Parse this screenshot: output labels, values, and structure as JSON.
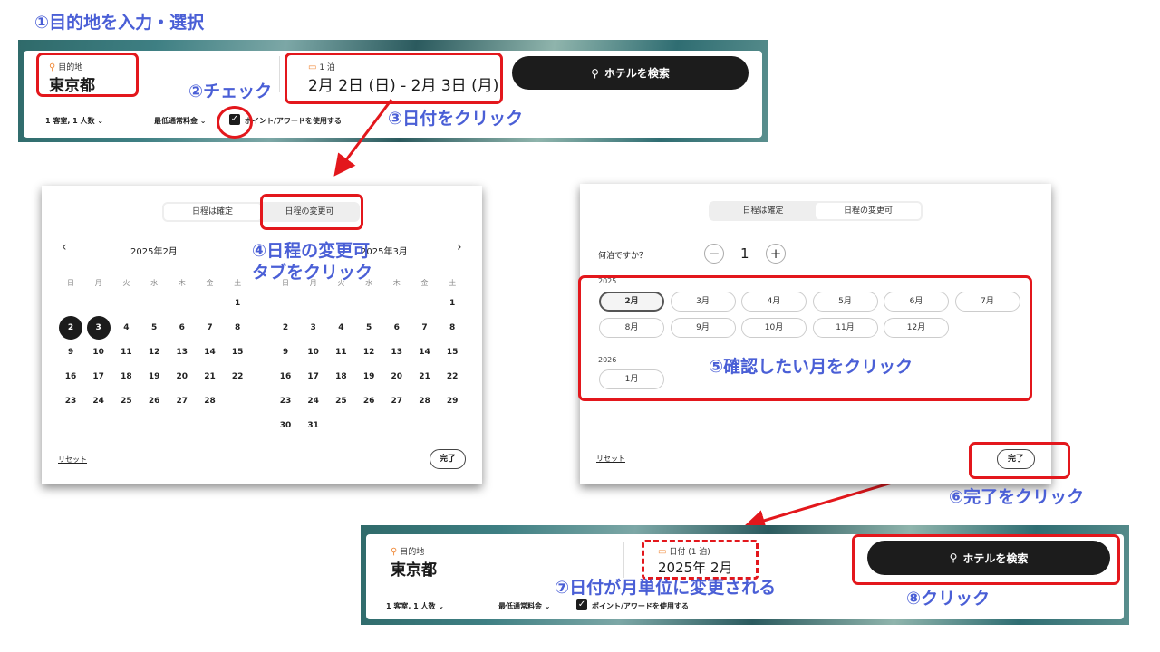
{
  "annotations": {
    "step1": "①目的地を入力・選択",
    "step2": "②チェック",
    "step3": "③日付をクリック",
    "step4_line1": "④日程の変更可",
    "step4_line2": "タブをクリック",
    "step5": "⑤確認したい月をクリック",
    "step6": "⑥完了をクリック",
    "step7": "⑦日付が月単位に変更される",
    "step8": "⑧クリック"
  },
  "top_bar": {
    "destination_label": "目的地",
    "destination_value": "東京都",
    "nights_label": "1 泊",
    "date_value": "2月 2日 (日) - 2月 3日 (月)",
    "search_label": "ホテルを検索",
    "guests": "1 客室, 1 人数",
    "rate": "最低通常料金",
    "points_label": "ポイント/アワードを使用する"
  },
  "calendar_panel": {
    "tab_fixed": "日程は確定",
    "tab_flexible": "日程の変更可",
    "month_left": "2025年2月",
    "month_right": "2025年3月",
    "weekdays": [
      "日",
      "月",
      "火",
      "水",
      "木",
      "金",
      "土"
    ],
    "feb_days": [
      "1",
      "2",
      "3",
      "4",
      "5",
      "6",
      "7",
      "8",
      "9",
      "10",
      "11",
      "12",
      "13",
      "14",
      "15",
      "16",
      "17",
      "18",
      "19",
      "20",
      "21",
      "22",
      "23",
      "24",
      "25",
      "26",
      "27",
      "28"
    ],
    "mar_days": [
      "1",
      "2",
      "3",
      "4",
      "5",
      "6",
      "7",
      "8",
      "9",
      "10",
      "11",
      "12",
      "13",
      "14",
      "15",
      "16",
      "17",
      "18",
      "19",
      "20",
      "21",
      "22",
      "23",
      "24",
      "25",
      "26",
      "27",
      "28",
      "29",
      "30",
      "31"
    ],
    "selected_days": [
      "2",
      "3"
    ],
    "reset": "リセット",
    "done": "完了"
  },
  "flex_panel": {
    "tab_fixed": "日程は確定",
    "tab_flexible": "日程の変更可",
    "nights_question": "何泊ですか？",
    "nights_value": "1",
    "minus": "−",
    "plus": "+",
    "year1": "2025",
    "months_2025": [
      "2月",
      "3月",
      "4月",
      "5月",
      "6月",
      "7月",
      "8月",
      "9月",
      "10月",
      "11月",
      "12月"
    ],
    "selected_month": "2月",
    "year2": "2026",
    "months_2026": [
      "1月"
    ],
    "reset": "リセット",
    "done": "完了"
  },
  "bottom_bar": {
    "destination_label": "目的地",
    "destination_value": "東京都",
    "date_label": "日付 (1 泊)",
    "date_value": "2025年 2月",
    "search_label": "ホテルを検索",
    "guests": "1 客室, 1 人数",
    "rate": "最低通常料金",
    "points_label": "ポイント/アワードを使用する"
  },
  "colors": {
    "annotation": "#4a5fd6",
    "highlight": "#e3171c",
    "button_dark": "#1c1c1c"
  }
}
